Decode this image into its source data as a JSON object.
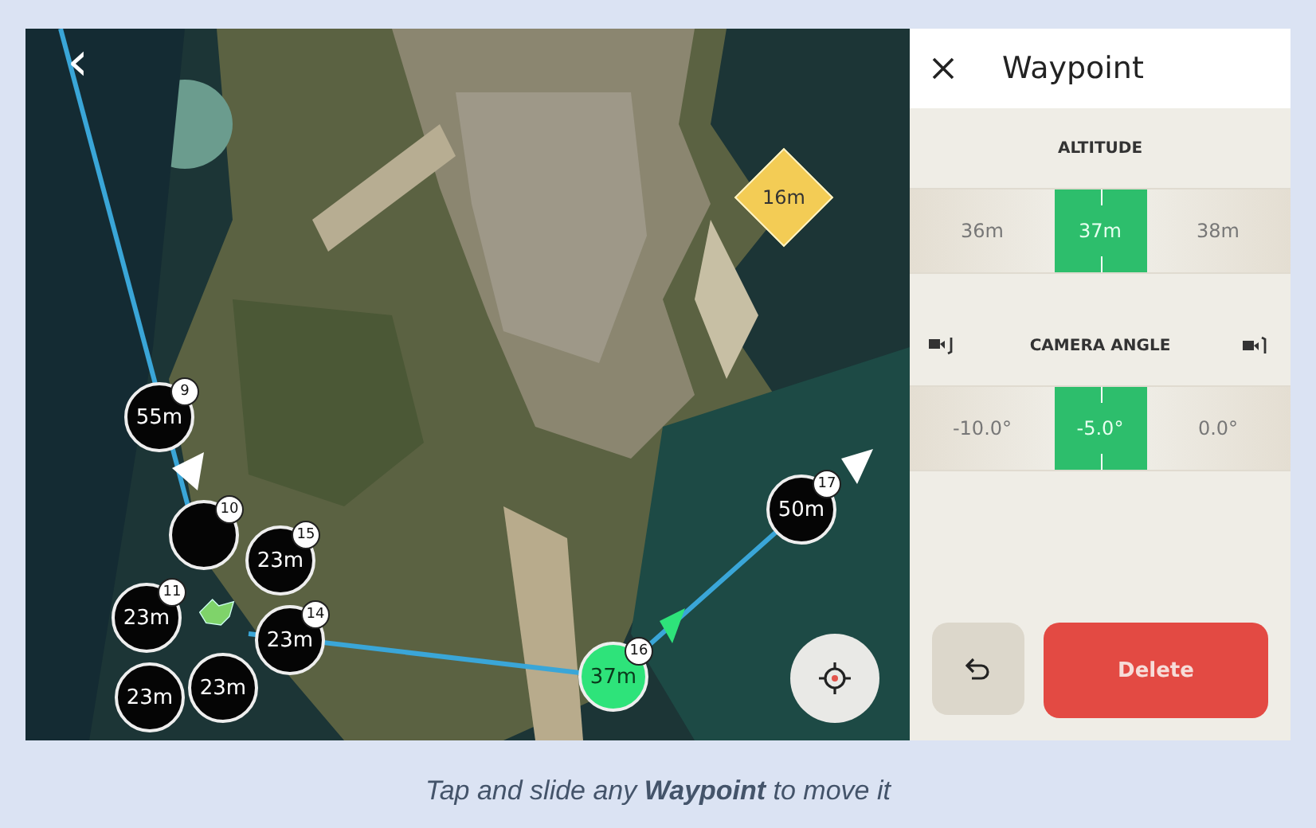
{
  "map": {
    "back": "‹",
    "waypoints": [
      {
        "number": "9",
        "label": "55m",
        "selected": false
      },
      {
        "number": "10",
        "selected": false
      },
      {
        "number": "11",
        "label": "23m",
        "selected": false
      },
      {
        "number": "14",
        "label": "23m",
        "selected": false
      },
      {
        "label": "23m",
        "selected": false
      },
      {
        "label": "23m",
        "selected": false
      },
      {
        "number": "15",
        "label": "23m",
        "selected": false
      },
      {
        "number": "17",
        "label": "50m",
        "selected": false
      },
      {
        "number": "16",
        "label": "37m",
        "selected": true
      }
    ],
    "poi": {
      "label": "16m"
    }
  },
  "panel": {
    "title": "Waypoint",
    "sections": [
      {
        "kind": "altitude",
        "label": "ALTITUDE",
        "options": [
          {
            "label": "36m",
            "selected": false
          },
          {
            "label": "37m",
            "selected": true
          },
          {
            "label": "38m",
            "selected": false
          }
        ]
      },
      {
        "kind": "camera",
        "label": "CAMERA ANGLE",
        "options": [
          {
            "label": "-10.0°",
            "selected": false
          },
          {
            "label": "-5.0°",
            "selected": true
          },
          {
            "label": "0.0°",
            "selected": false
          }
        ]
      }
    ],
    "delete": "Delete"
  },
  "caption": "Tap and slide any **Waypoint** to move it"
}
